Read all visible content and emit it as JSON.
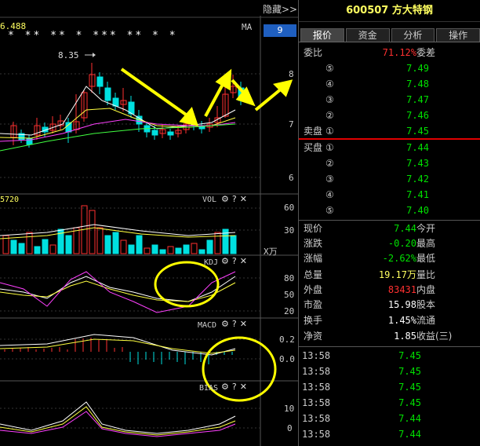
{
  "header": {
    "collapse_label": "隐藏>>",
    "ma_label": "MA",
    "ma_value": "6.488",
    "stars": "* ** ** * *** ** * *",
    "badge": "9"
  },
  "price_chart": {
    "high_marker": "8.35",
    "price_ticks": [
      "8",
      "7",
      "6"
    ]
  },
  "volume": {
    "label": "VOL",
    "left_value": "5720",
    "ticks": [
      "60",
      "30",
      "X万"
    ]
  },
  "kdj": {
    "label": "KDJ",
    "ticks": [
      "80",
      "50",
      "20"
    ]
  },
  "macd": {
    "label": "MACD",
    "ticks": [
      "0.2",
      "0.0"
    ]
  },
  "bias": {
    "label": "BIAS",
    "ticks": [
      "10",
      "0"
    ]
  },
  "indicator_icons": {
    "gear": "⚙",
    "help": "?",
    "close": "✕"
  },
  "stock": {
    "code": "600507",
    "name": "方大特钢"
  },
  "tabs": [
    "报价",
    "资金",
    "分析",
    "操作"
  ],
  "quote": {
    "weibi_label": "委比",
    "weibi_value": "71.12%",
    "weicha_label": "委差",
    "sell_label": "卖盘",
    "buy_label": "买盘",
    "levels": [
      "⑤",
      "④",
      "③",
      "②",
      "①"
    ],
    "buy_levels": [
      "①",
      "②",
      "③",
      "④",
      "⑤"
    ],
    "sell_prices": [
      "7.49",
      "7.48",
      "7.47",
      "7.46",
      "7.45"
    ],
    "buy_prices": [
      "7.44",
      "7.43",
      "7.42",
      "7.41",
      "7.40"
    ]
  },
  "stats": [
    {
      "label": "现价",
      "value": "7.44",
      "label2": "今开",
      "color": "green"
    },
    {
      "label": "涨跌",
      "value": "-0.20",
      "label2": "最高",
      "color": "green"
    },
    {
      "label": "涨幅",
      "value": "-2.62%",
      "label2": "最低",
      "color": "green"
    },
    {
      "label": "总量",
      "value": "19.17万",
      "label2": "量比",
      "color": "yellow"
    },
    {
      "label": "外盘",
      "value": "83431",
      "label2": "内盘",
      "color": "red"
    },
    {
      "label": "市盈",
      "value": "15.98",
      "label2": "股本",
      "color": "white"
    },
    {
      "label": "换手",
      "value": "1.45%",
      "label2": "流通",
      "color": "white"
    },
    {
      "label": "净资",
      "value": "1.85",
      "label2": "收益(三)",
      "color": "white"
    }
  ],
  "ticks": [
    {
      "time": "13:58",
      "price": "7.45"
    },
    {
      "time": "13:58",
      "price": "7.45"
    },
    {
      "time": "13:58",
      "price": "7.45"
    },
    {
      "time": "13:58",
      "price": "7.45"
    },
    {
      "time": "13:58",
      "price": "7.44"
    },
    {
      "time": "13:58",
      "price": "7.44"
    }
  ],
  "colors": {
    "up": "#ff3030",
    "down": "#00e0e0",
    "ma5": "#ffffff",
    "ma10": "#ffff40",
    "ma20": "#ff40ff",
    "ma60": "#40ff40",
    "annotation": "#ffff00"
  }
}
